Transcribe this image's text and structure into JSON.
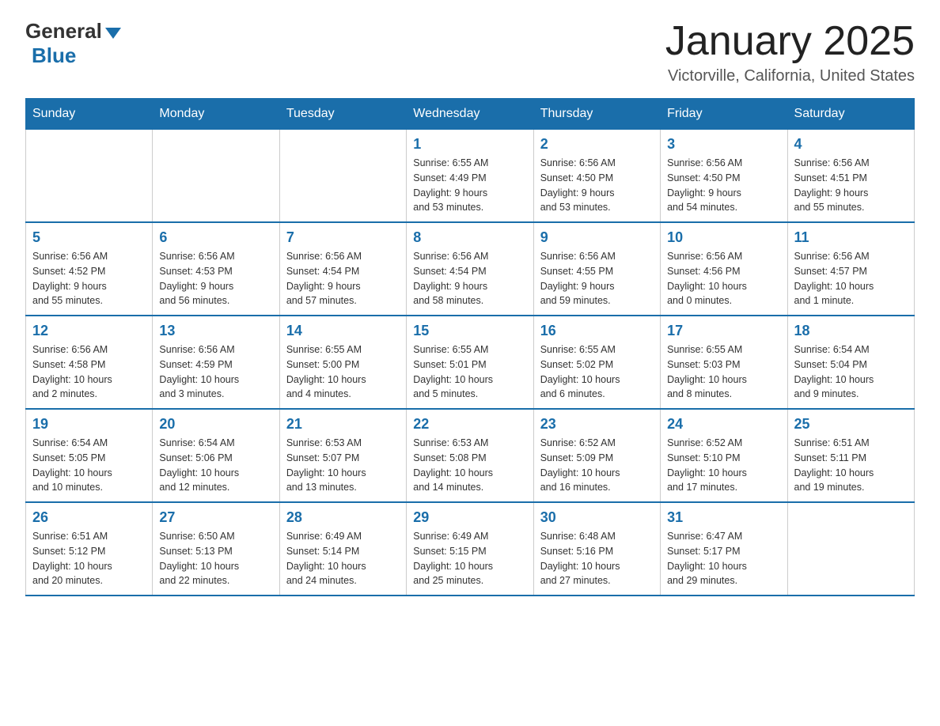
{
  "header": {
    "logo_general": "General",
    "logo_blue": "Blue",
    "month_title": "January 2025",
    "location": "Victorville, California, United States"
  },
  "days_of_week": [
    "Sunday",
    "Monday",
    "Tuesday",
    "Wednesday",
    "Thursday",
    "Friday",
    "Saturday"
  ],
  "weeks": [
    [
      {
        "day": "",
        "info": ""
      },
      {
        "day": "",
        "info": ""
      },
      {
        "day": "",
        "info": ""
      },
      {
        "day": "1",
        "info": "Sunrise: 6:55 AM\nSunset: 4:49 PM\nDaylight: 9 hours\nand 53 minutes."
      },
      {
        "day": "2",
        "info": "Sunrise: 6:56 AM\nSunset: 4:50 PM\nDaylight: 9 hours\nand 53 minutes."
      },
      {
        "day": "3",
        "info": "Sunrise: 6:56 AM\nSunset: 4:50 PM\nDaylight: 9 hours\nand 54 minutes."
      },
      {
        "day": "4",
        "info": "Sunrise: 6:56 AM\nSunset: 4:51 PM\nDaylight: 9 hours\nand 55 minutes."
      }
    ],
    [
      {
        "day": "5",
        "info": "Sunrise: 6:56 AM\nSunset: 4:52 PM\nDaylight: 9 hours\nand 55 minutes."
      },
      {
        "day": "6",
        "info": "Sunrise: 6:56 AM\nSunset: 4:53 PM\nDaylight: 9 hours\nand 56 minutes."
      },
      {
        "day": "7",
        "info": "Sunrise: 6:56 AM\nSunset: 4:54 PM\nDaylight: 9 hours\nand 57 minutes."
      },
      {
        "day": "8",
        "info": "Sunrise: 6:56 AM\nSunset: 4:54 PM\nDaylight: 9 hours\nand 58 minutes."
      },
      {
        "day": "9",
        "info": "Sunrise: 6:56 AM\nSunset: 4:55 PM\nDaylight: 9 hours\nand 59 minutes."
      },
      {
        "day": "10",
        "info": "Sunrise: 6:56 AM\nSunset: 4:56 PM\nDaylight: 10 hours\nand 0 minutes."
      },
      {
        "day": "11",
        "info": "Sunrise: 6:56 AM\nSunset: 4:57 PM\nDaylight: 10 hours\nand 1 minute."
      }
    ],
    [
      {
        "day": "12",
        "info": "Sunrise: 6:56 AM\nSunset: 4:58 PM\nDaylight: 10 hours\nand 2 minutes."
      },
      {
        "day": "13",
        "info": "Sunrise: 6:56 AM\nSunset: 4:59 PM\nDaylight: 10 hours\nand 3 minutes."
      },
      {
        "day": "14",
        "info": "Sunrise: 6:55 AM\nSunset: 5:00 PM\nDaylight: 10 hours\nand 4 minutes."
      },
      {
        "day": "15",
        "info": "Sunrise: 6:55 AM\nSunset: 5:01 PM\nDaylight: 10 hours\nand 5 minutes."
      },
      {
        "day": "16",
        "info": "Sunrise: 6:55 AM\nSunset: 5:02 PM\nDaylight: 10 hours\nand 6 minutes."
      },
      {
        "day": "17",
        "info": "Sunrise: 6:55 AM\nSunset: 5:03 PM\nDaylight: 10 hours\nand 8 minutes."
      },
      {
        "day": "18",
        "info": "Sunrise: 6:54 AM\nSunset: 5:04 PM\nDaylight: 10 hours\nand 9 minutes."
      }
    ],
    [
      {
        "day": "19",
        "info": "Sunrise: 6:54 AM\nSunset: 5:05 PM\nDaylight: 10 hours\nand 10 minutes."
      },
      {
        "day": "20",
        "info": "Sunrise: 6:54 AM\nSunset: 5:06 PM\nDaylight: 10 hours\nand 12 minutes."
      },
      {
        "day": "21",
        "info": "Sunrise: 6:53 AM\nSunset: 5:07 PM\nDaylight: 10 hours\nand 13 minutes."
      },
      {
        "day": "22",
        "info": "Sunrise: 6:53 AM\nSunset: 5:08 PM\nDaylight: 10 hours\nand 14 minutes."
      },
      {
        "day": "23",
        "info": "Sunrise: 6:52 AM\nSunset: 5:09 PM\nDaylight: 10 hours\nand 16 minutes."
      },
      {
        "day": "24",
        "info": "Sunrise: 6:52 AM\nSunset: 5:10 PM\nDaylight: 10 hours\nand 17 minutes."
      },
      {
        "day": "25",
        "info": "Sunrise: 6:51 AM\nSunset: 5:11 PM\nDaylight: 10 hours\nand 19 minutes."
      }
    ],
    [
      {
        "day": "26",
        "info": "Sunrise: 6:51 AM\nSunset: 5:12 PM\nDaylight: 10 hours\nand 20 minutes."
      },
      {
        "day": "27",
        "info": "Sunrise: 6:50 AM\nSunset: 5:13 PM\nDaylight: 10 hours\nand 22 minutes."
      },
      {
        "day": "28",
        "info": "Sunrise: 6:49 AM\nSunset: 5:14 PM\nDaylight: 10 hours\nand 24 minutes."
      },
      {
        "day": "29",
        "info": "Sunrise: 6:49 AM\nSunset: 5:15 PM\nDaylight: 10 hours\nand 25 minutes."
      },
      {
        "day": "30",
        "info": "Sunrise: 6:48 AM\nSunset: 5:16 PM\nDaylight: 10 hours\nand 27 minutes."
      },
      {
        "day": "31",
        "info": "Sunrise: 6:47 AM\nSunset: 5:17 PM\nDaylight: 10 hours\nand 29 minutes."
      },
      {
        "day": "",
        "info": ""
      }
    ]
  ]
}
